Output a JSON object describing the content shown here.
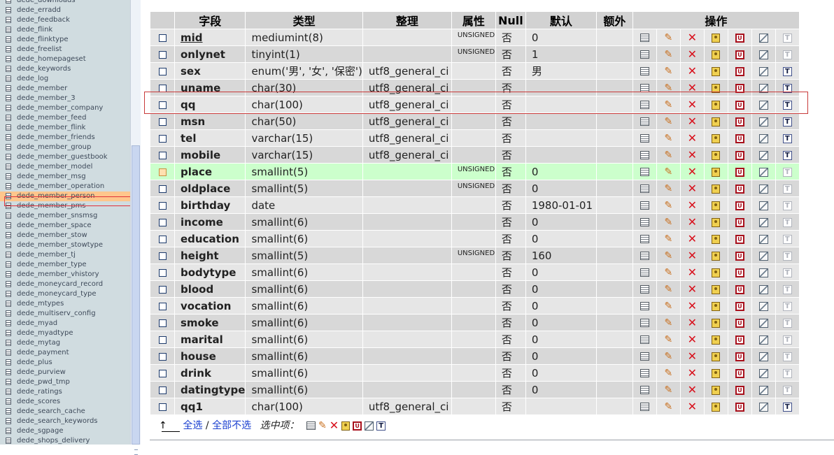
{
  "sidebar": {
    "items": [
      "dede_downloads",
      "dede_erradd",
      "dede_feedback",
      "dede_flink",
      "dede_flinktype",
      "dede_freelist",
      "dede_homepageset",
      "dede_keywords",
      "dede_log",
      "dede_member",
      "dede_member_3",
      "dede_member_company",
      "dede_member_feed",
      "dede_member_flink",
      "dede_member_friends",
      "dede_member_group",
      "dede_member_guestbook",
      "dede_member_model",
      "dede_member_msg",
      "dede_member_operation",
      "dede_member_person",
      "dede_member_pms",
      "dede_member_snsmsg",
      "dede_member_space",
      "dede_member_stow",
      "dede_member_stowtype",
      "dede_member_tj",
      "dede_member_type",
      "dede_member_vhistory",
      "dede_moneycard_record",
      "dede_moneycard_type",
      "dede_mtypes",
      "dede_multiserv_config",
      "dede_myad",
      "dede_myadtype",
      "dede_mytag",
      "dede_payment",
      "dede_plus",
      "dede_purview",
      "dede_pwd_tmp",
      "dede_ratings",
      "dede_scores",
      "dede_search_cache",
      "dede_search_keywords",
      "dede_sgpage",
      "dede_shops_delivery"
    ],
    "selected_index": 20
  },
  "table": {
    "headers": {
      "field": "字段",
      "type": "类型",
      "collation": "整理",
      "attributes": "属性",
      "null": "Null",
      "default": "默认",
      "extra": "额外",
      "action": "操作"
    },
    "rows": [
      {
        "name": "mid",
        "type": "mediumint(8)",
        "collation": "",
        "attr": "UNSIGNED",
        "null": "否",
        "default": "0",
        "pk": true
      },
      {
        "name": "onlynet",
        "type": "tinyint(1)",
        "collation": "",
        "attr": "UNSIGNED",
        "null": "否",
        "default": "1"
      },
      {
        "name": "sex",
        "type": "enum('男', '女', '保密')",
        "collation": "utf8_general_ci",
        "attr": "",
        "null": "否",
        "default": "男"
      },
      {
        "name": "uname",
        "type": "char(30)",
        "collation": "utf8_general_ci",
        "attr": "",
        "null": "否",
        "default": ""
      },
      {
        "name": "qq",
        "type": "char(100)",
        "collation": "utf8_general_ci",
        "attr": "",
        "null": "否",
        "default": ""
      },
      {
        "name": "msn",
        "type": "char(50)",
        "collation": "utf8_general_ci",
        "attr": "",
        "null": "否",
        "default": ""
      },
      {
        "name": "tel",
        "type": "varchar(15)",
        "collation": "utf8_general_ci",
        "attr": "",
        "null": "否",
        "default": ""
      },
      {
        "name": "mobile",
        "type": "varchar(15)",
        "collation": "utf8_general_ci",
        "attr": "",
        "null": "否",
        "default": ""
      },
      {
        "name": "place",
        "type": "smallint(5)",
        "collation": "",
        "attr": "UNSIGNED",
        "null": "否",
        "default": "0",
        "marked": true
      },
      {
        "name": "oldplace",
        "type": "smallint(5)",
        "collation": "",
        "attr": "UNSIGNED",
        "null": "否",
        "default": "0"
      },
      {
        "name": "birthday",
        "type": "date",
        "collation": "",
        "attr": "",
        "null": "否",
        "default": "1980-01-01"
      },
      {
        "name": "income",
        "type": "smallint(6)",
        "collation": "",
        "attr": "",
        "null": "否",
        "default": "0"
      },
      {
        "name": "education",
        "type": "smallint(6)",
        "collation": "",
        "attr": "",
        "null": "否",
        "default": "0"
      },
      {
        "name": "height",
        "type": "smallint(5)",
        "collation": "",
        "attr": "UNSIGNED",
        "null": "否",
        "default": "160"
      },
      {
        "name": "bodytype",
        "type": "smallint(6)",
        "collation": "",
        "attr": "",
        "null": "否",
        "default": "0"
      },
      {
        "name": "blood",
        "type": "smallint(6)",
        "collation": "",
        "attr": "",
        "null": "否",
        "default": "0"
      },
      {
        "name": "vocation",
        "type": "smallint(6)",
        "collation": "",
        "attr": "",
        "null": "否",
        "default": "0"
      },
      {
        "name": "smoke",
        "type": "smallint(6)",
        "collation": "",
        "attr": "",
        "null": "否",
        "default": "0"
      },
      {
        "name": "marital",
        "type": "smallint(6)",
        "collation": "",
        "attr": "",
        "null": "否",
        "default": "0"
      },
      {
        "name": "house",
        "type": "smallint(6)",
        "collation": "",
        "attr": "",
        "null": "否",
        "default": "0"
      },
      {
        "name": "drink",
        "type": "smallint(6)",
        "collation": "",
        "attr": "",
        "null": "否",
        "default": "0"
      },
      {
        "name": "datingtype",
        "type": "smallint(6)",
        "collation": "",
        "attr": "",
        "null": "否",
        "default": "0"
      },
      {
        "name": "qq1",
        "type": "char(100)",
        "collation": "utf8_general_ci",
        "attr": "",
        "null": "否",
        "default": ""
      }
    ],
    "unique_glyph": "U",
    "fulltext_glyph": "T"
  },
  "footer": {
    "select_all": "全选",
    "separator": " / ",
    "deselect_all": "全部不选",
    "with_selected": "选中项："
  },
  "colors": {
    "marked_row": "#ccffcc",
    "highlight_border": "#c83a3a",
    "link": "#1a3fd0",
    "drop_icon": "#d8101c"
  }
}
